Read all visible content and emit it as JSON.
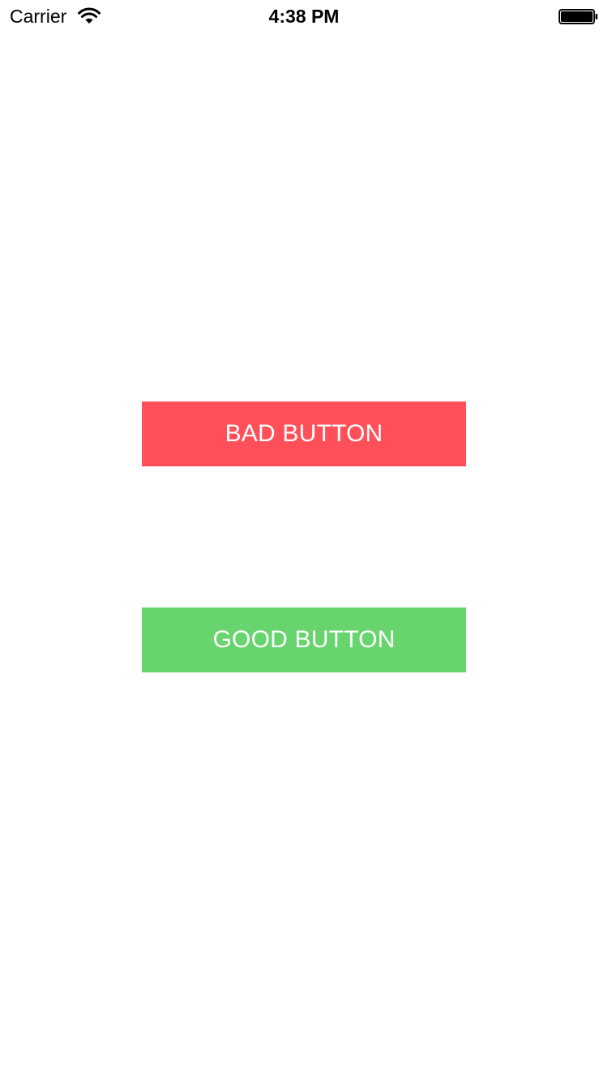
{
  "status_bar": {
    "carrier": "Carrier",
    "time": "4:38 PM",
    "wifi_icon": "wifi-icon",
    "battery_icon": "battery-icon"
  },
  "buttons": {
    "bad": {
      "label": "BAD BUTTON",
      "color": "#ff5059"
    },
    "good": {
      "label": "GOOD BUTTON",
      "color": "#68d46d"
    }
  }
}
